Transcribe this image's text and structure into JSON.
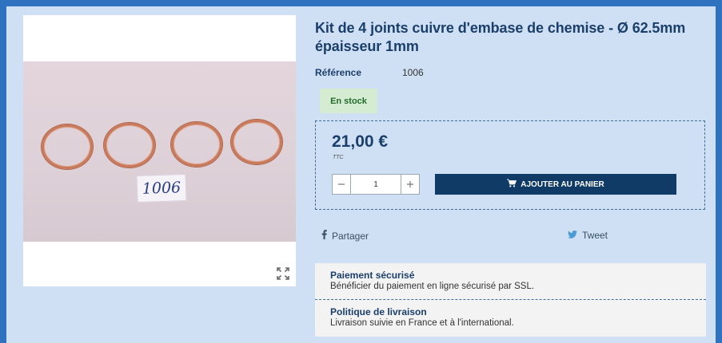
{
  "product": {
    "title": "Kit de 4 joints cuivre d'embase de chemise - Ø 62.5mm épaisseur 1mm",
    "reference_label": "Référence",
    "reference_value": "1006",
    "stock_label": "En stock",
    "photo_tag": "1006"
  },
  "purchase": {
    "price": "21,00 €",
    "tax_label": "TTC",
    "quantity": "1",
    "add_to_cart_label": "AJOUTER AU PANIER"
  },
  "social": {
    "share_label": "Partager",
    "tweet_label": "Tweet"
  },
  "reassurance": {
    "items": [
      {
        "title": "Paiement sécurisé",
        "description": "Bénéficier du paiement en ligne sécurisé par SSL."
      },
      {
        "title": "Politique de livraison",
        "description": "Livraison suivie en France et à l'international."
      }
    ]
  },
  "colors": {
    "page_background": "#cfe0f4",
    "accent": "#0f3b66",
    "stock_badge": "#d5ecd3"
  },
  "icons": [
    "expand-icon",
    "cart-icon",
    "facebook-icon",
    "twitter-icon"
  ]
}
